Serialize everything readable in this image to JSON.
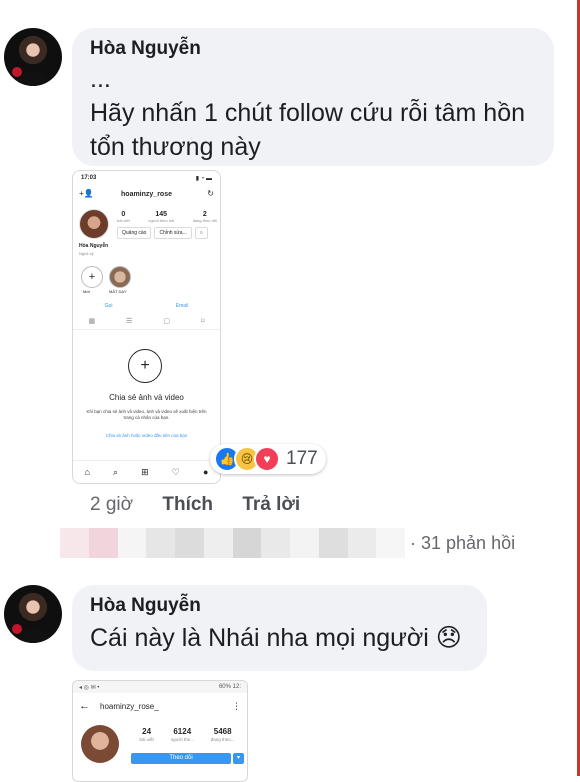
{
  "comments": [
    {
      "author": "Hòa Nguyễn",
      "lines": [
        "...",
        "Hãy nhấn 1 chút follow cứu rỗi tâm hồn",
        "tổn thương này"
      ],
      "time": "2 giờ",
      "like_label": "Thích",
      "reply_label": "Trả lời",
      "reaction_count": "177",
      "replies_label": "31 phản hồi"
    },
    {
      "author": "Hòa Nguyễn",
      "message": "Cái này là Nhái nha mọi người 😞"
    }
  ],
  "phone1": {
    "status_time": "17:03",
    "username": "hoaminzy_rose",
    "stats": [
      {
        "value": "0",
        "label": "bài viết"
      },
      {
        "value": "145",
        "label": "người theo dõi"
      },
      {
        "value": "2",
        "label": "đang theo dõi"
      }
    ],
    "btn_ads": "Quảng cáo",
    "btn_edit": "Chỉnh sửa...",
    "name": "Hòa Nguyễn",
    "role": "Nghệ sỹ",
    "highlight_new": "Mới",
    "highlight_story": "MẤT DẠY",
    "link_call": "Gọi",
    "link_email": "Email",
    "empty_title": "Chia sẻ ảnh và video",
    "empty_desc": "Khi bạn chia sẻ ảnh và video, ảnh và video sẽ xuất hiện trên trang cá nhân của bạn.",
    "empty_link": "Chia sẻ ảnh hoặc video đầu tiên của bạn"
  },
  "phone2": {
    "status_right": "60% 12:",
    "username": "hoaminzy_rose_",
    "stats": [
      {
        "value": "24",
        "label": "bài viết"
      },
      {
        "value": "6124",
        "label": "người the..."
      },
      {
        "value": "5468",
        "label": "đang theo..."
      }
    ],
    "follow_label": "Theo dõi"
  }
}
